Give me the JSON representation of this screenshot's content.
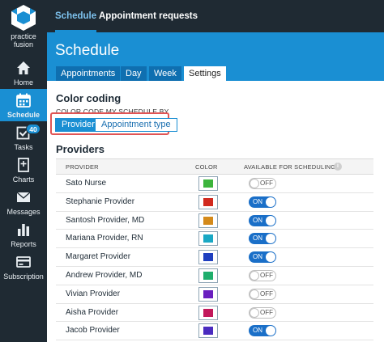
{
  "sidebar": {
    "logo_text": "practice fusion",
    "items": [
      {
        "label": "Home",
        "icon": "home-icon",
        "active": false
      },
      {
        "label": "Schedule",
        "icon": "calendar-icon",
        "active": true
      },
      {
        "label": "Tasks",
        "icon": "checkbox-icon",
        "active": false,
        "badge": "40"
      },
      {
        "label": "Charts",
        "icon": "chart-doc-icon",
        "active": false
      },
      {
        "label": "Messages",
        "icon": "envelope-icon",
        "active": false
      },
      {
        "label": "Reports",
        "icon": "bar-chart-icon",
        "active": false
      },
      {
        "label": "Subscription",
        "icon": "subscription-icon",
        "active": false
      }
    ]
  },
  "topbar": {
    "tabs": [
      "Schedule",
      "Appointment requests"
    ]
  },
  "header": {
    "title": "Schedule",
    "subtabs": [
      "Appointments",
      "Day",
      "Week",
      "Settings"
    ]
  },
  "coloring": {
    "title": "Color coding",
    "caption": "COLOR CODE MY SCHEDULE BY",
    "options": [
      "Provider",
      "Appointment type"
    ]
  },
  "providers": {
    "title": "Providers",
    "columns": [
      "PROVIDER",
      "COLOR",
      "AVAILABLE FOR SCHEDULING"
    ],
    "info_icon": "i",
    "rows": [
      {
        "name": "Sato Nurse",
        "color": "#3cb43c",
        "available": false
      },
      {
        "name": "Stephanie Provider",
        "color": "#d12a1f",
        "available": true
      },
      {
        "name": "Santosh Provider, MD",
        "color": "#d48a1a",
        "available": true
      },
      {
        "name": "Mariana Provider, RN",
        "color": "#19a8c4",
        "available": true
      },
      {
        "name": "Margaret Provider",
        "color": "#1f3fbf",
        "available": true
      },
      {
        "name": "Andrew Provider, MD",
        "color": "#1fae6c",
        "available": false
      },
      {
        "name": "Vivian Provider",
        "color": "#6a1fbf",
        "available": false
      },
      {
        "name": "Aisha Provider",
        "color": "#c2185b",
        "available": false
      },
      {
        "name": "Jacob Provider",
        "color": "#4a2bbf",
        "available": true
      }
    ],
    "toggle_on": "ON",
    "toggle_off": "OFF"
  }
}
